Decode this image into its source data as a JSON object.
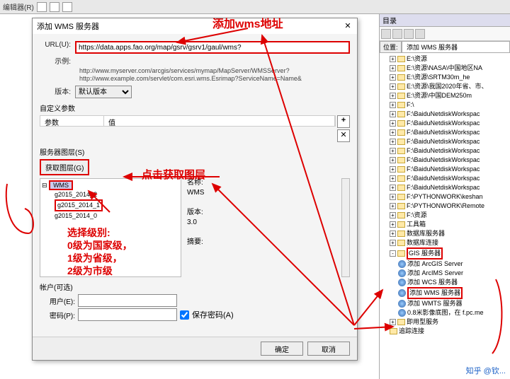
{
  "toolbar": {
    "editor": "编辑器(R)"
  },
  "dialog": {
    "title": "添加 WMS 服务器",
    "url_label": "URL(U):",
    "url_value": "https://data.apps.fao.org/map/gsrv/gsrv1/gaul/wms?",
    "example_label": "示例:",
    "example1": "http://www.myserver.com/arcgis/services/mymap/MapServer/WMSServer?",
    "example2": "http://www.example.com/servlet/com.esri.wms.Esrimap?ServiceName=Name&",
    "version_label": "版本:",
    "version_value": "默认版本",
    "custom_params": "自定义参数",
    "param_col1": "参数",
    "param_col2": "值",
    "server_layers": "服务器图层(S)",
    "get_layers": "获取图层(G)",
    "tree_root": "WMS",
    "layer0": "g2015_2014_2",
    "layer1": "g2015_2014_1",
    "layer2": "g2015_2014_0",
    "name_label": "名称:",
    "name_value": "WMS",
    "ver_label": "版本:",
    "ver_value": "3.0",
    "abstract_label": "摘要:",
    "account": "帐户(可选)",
    "user_label": "用户(E):",
    "pwd_label": "密码(P):",
    "save_pwd": "保存密码(A)",
    "ok": "确定",
    "cancel": "取消"
  },
  "catalog": {
    "title": "目录",
    "tab_pos": "位置:",
    "tab_add": "添加 WMS 服务器",
    "nodes": [
      "E:\\资源",
      "E:\\资源\\NASA\\中国地区NA",
      "E:\\资源\\SRTM30m_he",
      "E:\\资源\\我国2020年省、市、",
      "E:\\资源\\中国DEM250m",
      "F:\\",
      "F:\\BaiduNetdiskWorkspac",
      "F:\\BaiduNetdiskWorkspac",
      "F:\\BaiduNetdiskWorkspac",
      "F:\\BaiduNetdiskWorkspac",
      "F:\\BaiduNetdiskWorkspac",
      "F:\\BaiduNetdiskWorkspac",
      "F:\\BaiduNetdiskWorkspac",
      "F:\\BaiduNetdiskWorkspac",
      "F:\\BaiduNetdiskWorkspac",
      "F:\\PYTHONWORK\\keshan",
      "F:\\PYTHONWORK\\Remote",
      "F:\\资源"
    ],
    "toolbox": "工具箱",
    "db": "数据库服务器",
    "dbconn": "数据库连接",
    "gis": "GIS 服务器",
    "arcgis": "添加 ArcGIS Server",
    "arcims": "添加 ArcIMS Server",
    "wcs": "添加 WCS 服务器",
    "wms": "添加 WMS 服务器",
    "wmts": "添加 WMTS 服务器",
    "img08": "0.8米影像底图，在 f.pc.me",
    "ready1": "即用型服务",
    "ready2": "追踪连接"
  },
  "anno": {
    "a1": "添加wms地址",
    "a2": "点击获取图层",
    "a3": "选择级别:\n0级为国家级，\n1级为省级，\n2级为市级"
  },
  "watermark": "知乎 @钦..."
}
